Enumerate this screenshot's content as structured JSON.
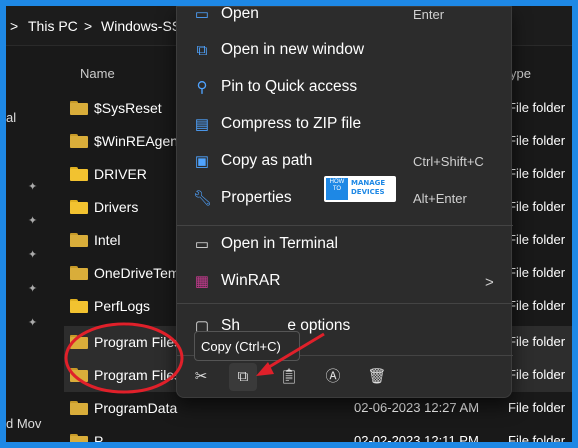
{
  "breadcrumb": {
    "chevron1": ">",
    "this_pc": "This PC",
    "chevron2": ">",
    "drive": "Windows-SS"
  },
  "sidebar": {
    "label1": "al",
    "label2": "d Mov"
  },
  "columns": {
    "name": "Name",
    "type": "ype"
  },
  "files": [
    {
      "name": "$SysReset",
      "date": "",
      "type": "File folder"
    },
    {
      "name": "$WinREAgent",
      "date": "",
      "type": "File folder"
    },
    {
      "name": "DRIVER",
      "date": "",
      "type": "File folder"
    },
    {
      "name": "Drivers",
      "date": "",
      "type": "File folder"
    },
    {
      "name": "Intel",
      "date": "",
      "type": "File folder"
    },
    {
      "name": "OneDriveTemp",
      "date": "",
      "type": "File folder"
    },
    {
      "name": "PerfLogs",
      "date": "",
      "type": "File folder"
    },
    {
      "name": "Program Files",
      "date": "",
      "type": "File folder"
    },
    {
      "name": "Program Files",
      "date": "",
      "type": "File folder"
    },
    {
      "name": "ProgramData",
      "date": "02-06-2023 12:27 AM",
      "type": "File folder"
    },
    {
      "name": "P",
      "date": "02-02-2023 12:11 PM",
      "type": "File folder"
    }
  ],
  "context_menu": {
    "open": {
      "label": "Open",
      "shortcut": "Enter",
      "icon": "open-icon"
    },
    "open_new_window": {
      "label": "Open in new window",
      "icon": "new-window-icon"
    },
    "pin_quick": {
      "label": "Pin to Quick access",
      "icon": "pin-icon"
    },
    "compress_zip": {
      "label": "Compress to ZIP file",
      "icon": "zip-icon"
    },
    "copy_path": {
      "label": "Copy as path",
      "shortcut": "Ctrl+Shift+C",
      "icon": "path-icon"
    },
    "properties": {
      "label": "Properties",
      "shortcut": "Alt+Enter",
      "icon": "wrench-icon"
    },
    "open_terminal": {
      "label": "Open in Terminal",
      "icon": "terminal-icon"
    },
    "winrar": {
      "label": "WinRAR",
      "icon": "winrar-icon",
      "submenu": ">"
    },
    "more_options": {
      "label": "Sh           e options"
    },
    "tooltip": "Copy (Ctrl+C)"
  },
  "icon_bar": [
    "cut-icon",
    "copy-icon",
    "paste-icon",
    "rename-icon",
    "delete-icon"
  ],
  "watermark": {
    "line1": "HOW",
    "line2": "TO",
    "line3": "MANAGE",
    "line4": "DEVICES"
  },
  "colors": {
    "frame": "#1e88e5",
    "accent": "#4fa3ff",
    "annotation": "#e0202a"
  }
}
